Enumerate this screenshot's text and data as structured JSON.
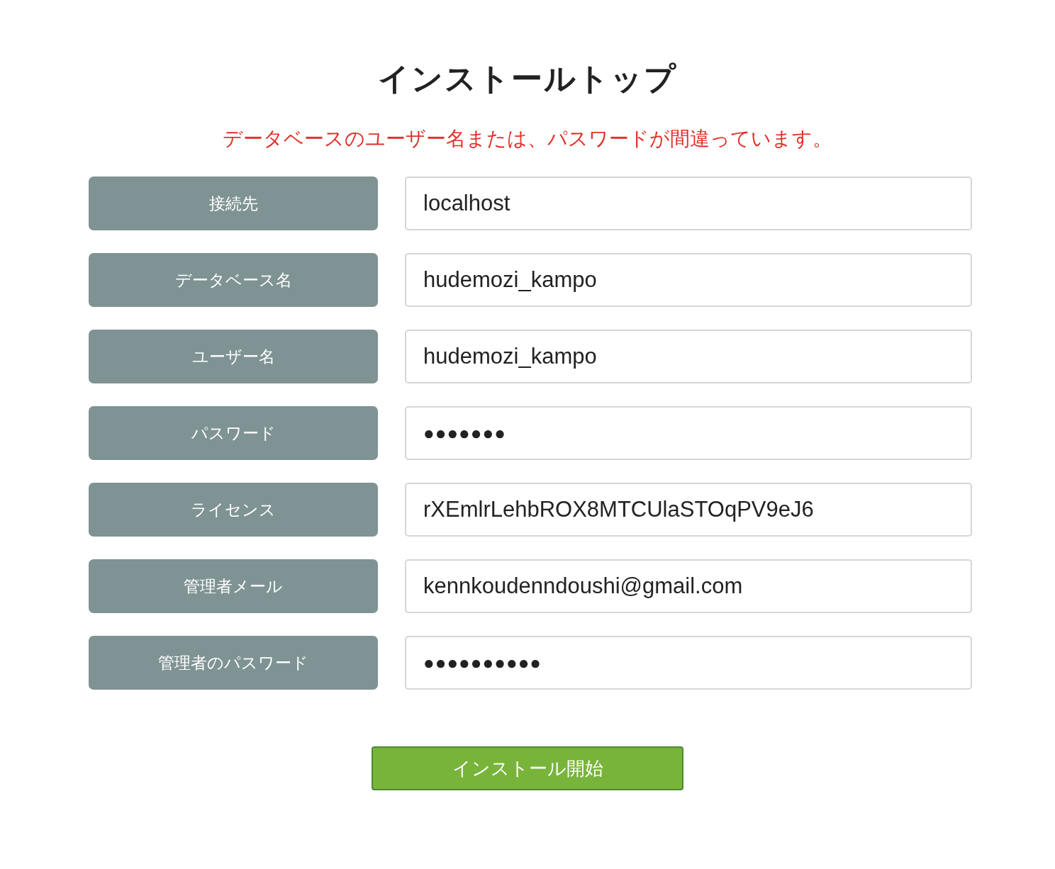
{
  "title": "インストールトップ",
  "error": "データベースのユーザー名または、パスワードが間違っています。",
  "fields": [
    {
      "label": "接続先",
      "kind": "text",
      "value": "localhost"
    },
    {
      "label": "データベース名",
      "kind": "text",
      "value": "hudemozi_kampo"
    },
    {
      "label": "ユーザー名",
      "kind": "text",
      "value": "hudemozi_kampo"
    },
    {
      "label": "パスワード",
      "kind": "password",
      "value": "●●●●●●●"
    },
    {
      "label": "ライセンス",
      "kind": "text",
      "value": "rXEmlrLehbROX8MTCUlaSTOqPV9eJ6"
    },
    {
      "label": "管理者メール",
      "kind": "text",
      "value": "kennkoudenndoushi@gmail.com"
    },
    {
      "label": "管理者のパスワード",
      "kind": "password",
      "value": "●●●●●●●●●●"
    }
  ],
  "submit": "インストール開始"
}
